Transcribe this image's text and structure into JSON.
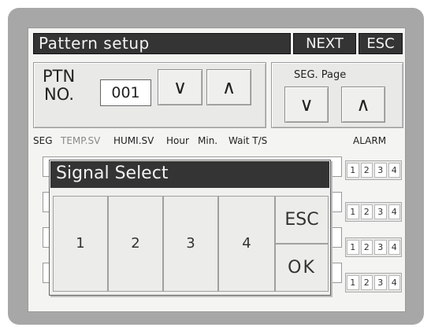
{
  "screen": {
    "title": "Pattern setup",
    "next_label": "NEXT",
    "esc_label": "ESC"
  },
  "pattern": {
    "ptn_label_1": "PTN",
    "ptn_label_2": "NO.",
    "ptn_value": "001",
    "down_symbol": "∨",
    "up_symbol": "∧"
  },
  "seg_page": {
    "label": "SEG. Page",
    "down_symbol": "∨",
    "up_symbol": "∧"
  },
  "table": {
    "headers": [
      "SEG",
      "TEMP.SV",
      "HUMI.SV",
      "Hour",
      "Min.",
      "Wait T/S",
      "ALARM"
    ],
    "alarm_numbers": [
      "1",
      "2",
      "3",
      "4"
    ]
  },
  "dialog": {
    "title": "Signal Select",
    "signals": [
      "1",
      "2",
      "3",
      "4"
    ],
    "esc_label": "ESC",
    "ok_label": "OK"
  },
  "colors": {
    "title_bar": "#343434",
    "screen_bg": "#f4f4f2",
    "bezel": "#a7a7a7",
    "disabled_text": "#8a8a8a"
  }
}
